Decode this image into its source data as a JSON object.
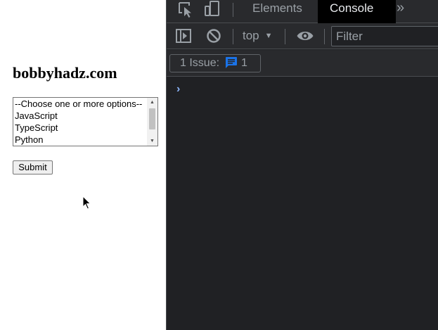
{
  "page": {
    "site_title": "bobbyhadz.com",
    "select": {
      "options": [
        "--Choose one or more options--",
        "JavaScript",
        "TypeScript",
        "Python"
      ]
    },
    "submit_label": "Submit"
  },
  "devtools": {
    "tabs": {
      "elements": "Elements",
      "console": "Console",
      "more": "»"
    },
    "toolbar": {
      "context": "top",
      "filter_placeholder": "Filter"
    },
    "issues": {
      "label": "1 Issue:",
      "count": "1"
    },
    "prompt": "›"
  },
  "colors": {
    "devtools_bg": "#202124",
    "toolbar_bg": "#292a2d",
    "console_tab_bg": "#000000",
    "accent_blue": "#8ab4f8",
    "issue_icon": "#1a73e8"
  },
  "icons": {
    "inspect": "inspect-element-icon",
    "device": "device-toolbar-icon",
    "sidebar": "show-sidebar-icon",
    "clear": "clear-console-icon",
    "eye": "live-expression-icon",
    "issue": "message-icon",
    "cursor": "mouse-cursor-icon"
  }
}
